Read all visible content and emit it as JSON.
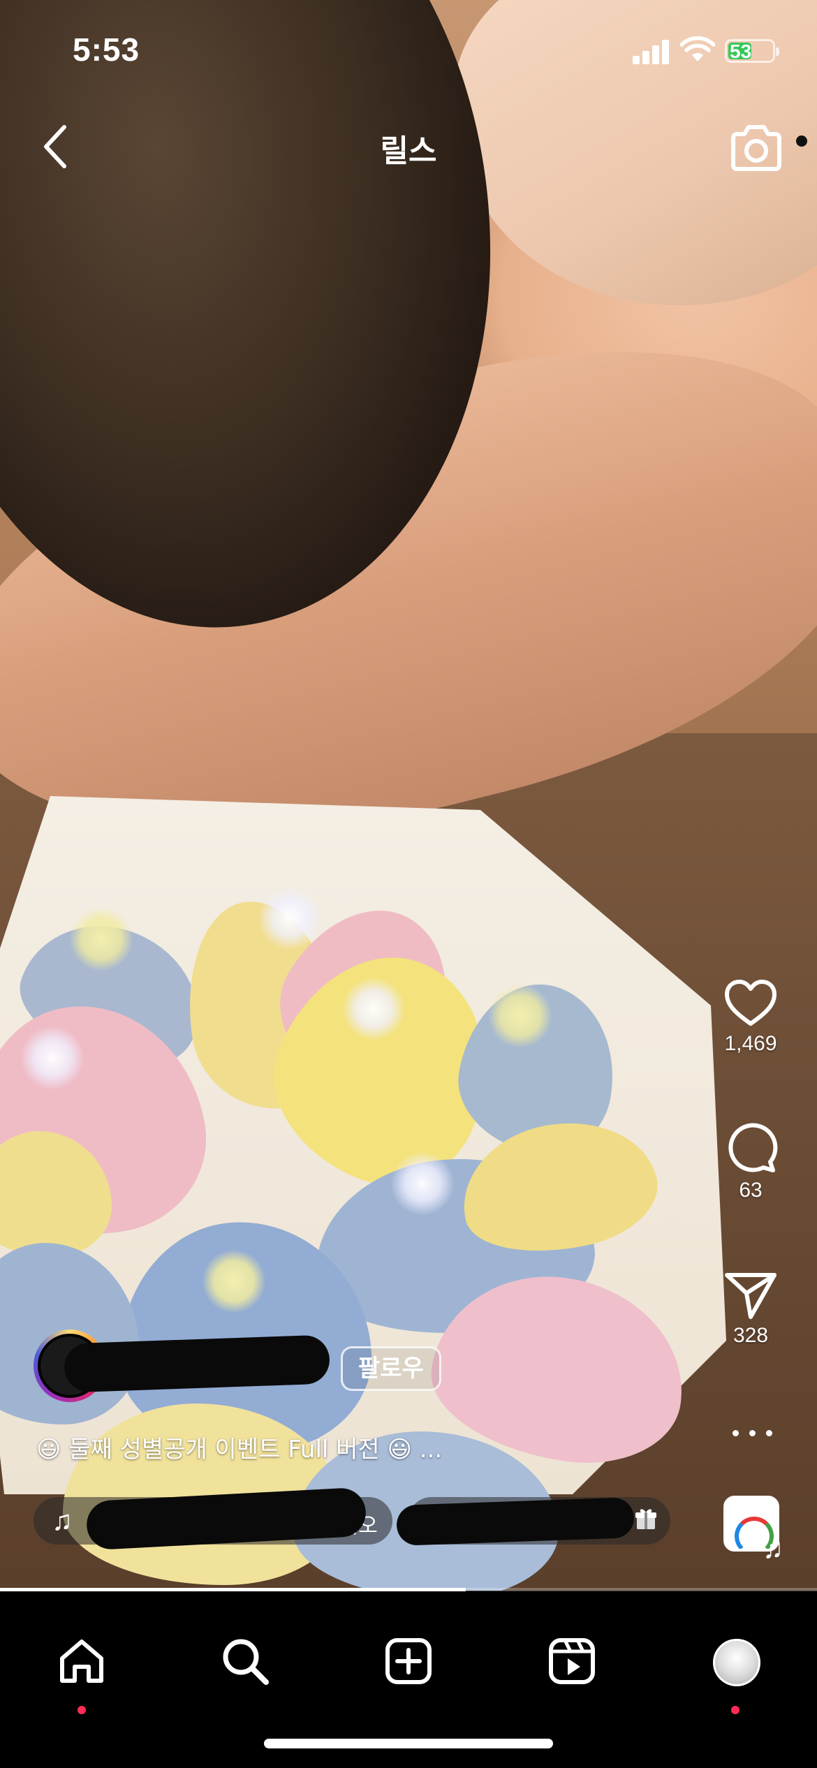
{
  "status_bar": {
    "time": "5:53",
    "battery_level": "53",
    "battery_color": "#34c759"
  },
  "header": {
    "title": "릴스",
    "back_icon": "chevron-left-icon",
    "camera_icon": "camera-icon"
  },
  "actions": {
    "likes": "1,469",
    "comments": "63",
    "shares": "328",
    "like_icon": "heart-icon",
    "comment_icon": "comment-bubble-icon",
    "share_icon": "paper-plane-icon",
    "more_icon": "more-horizontal-icon"
  },
  "author": {
    "follow_label": "팔로우"
  },
  "caption": {
    "text": "😃 둘째 성별공개 이벤트 Full 버전 😃  ..."
  },
  "audio": {
    "label": "오디오",
    "note_icon": "music-note-icon"
  },
  "location": {
    "gift_icon": "gift-icon"
  },
  "playback": {
    "progress_fraction": 0.57
  },
  "tabbar": {
    "items": [
      {
        "name": "home",
        "icon": "home-icon",
        "has_dot": true
      },
      {
        "name": "search",
        "icon": "search-icon",
        "has_dot": false
      },
      {
        "name": "create",
        "icon": "plus-square-icon",
        "has_dot": false
      },
      {
        "name": "reels",
        "icon": "reels-icon",
        "has_dot": false
      },
      {
        "name": "profile",
        "icon": "profile-avatar-icon",
        "has_dot": true
      }
    ],
    "notification_color": "#ff2d55"
  }
}
